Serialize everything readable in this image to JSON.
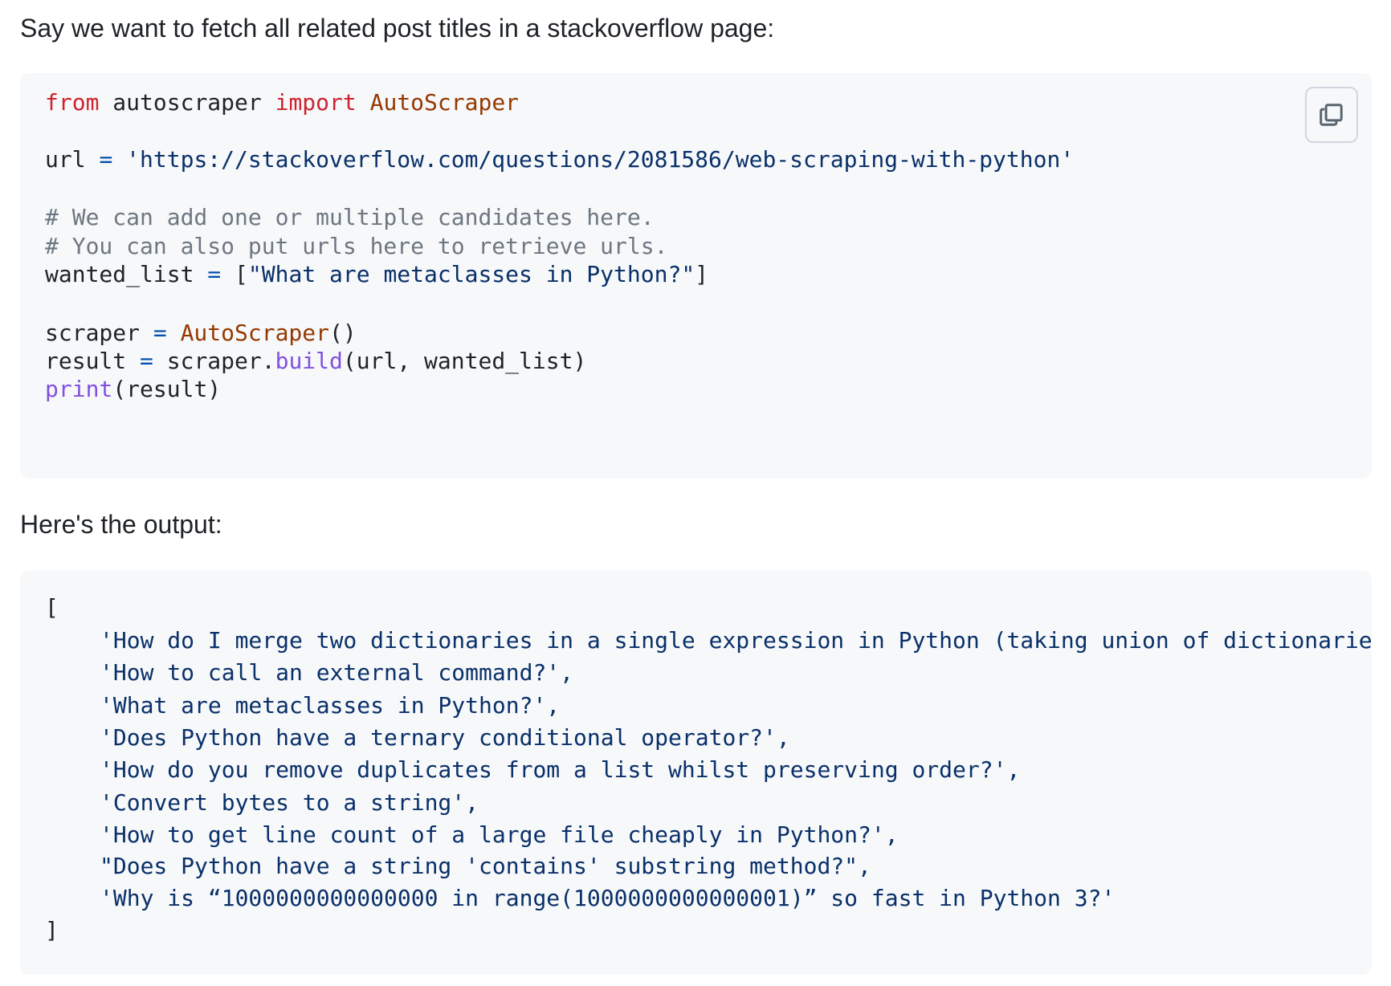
{
  "intro_text": "Say we want to fetch all related post titles in a stackoverflow page:",
  "outro_text": "Here's the output:",
  "copy_icon": "copy-icon",
  "colors": {
    "keyword": "#cf222e",
    "class_name": "#953800",
    "operator": "#0550ae",
    "string": "#0a3069",
    "comment": "#6e7781",
    "function": "#8250df",
    "code_background": "#f6f8fa"
  },
  "code": {
    "line1": {
      "kw_from": "from",
      "module": " autoscraper ",
      "kw_import": "import",
      "cls": " AutoScraper"
    },
    "line2": {
      "var": "url ",
      "op": "=",
      "str": " 'https://stackoverflow.com/questions/2081586/web-scraping-with-python'"
    },
    "comment1": "# We can add one or multiple candidates here.",
    "comment2": "# You can also put urls here to retrieve urls.",
    "line5": {
      "var": "wanted_list ",
      "op": "=",
      "open": " [",
      "str": "\"What are metaclasses in Python?\"",
      "close": "]"
    },
    "line6": {
      "var": "scraper ",
      "op": "=",
      "cls": " AutoScraper",
      "parens": "()"
    },
    "line7": {
      "var": "result ",
      "op": "=",
      "obj": " scraper.",
      "fn": "build",
      "args": "(url, wanted_list)"
    },
    "line8": {
      "fn": "print",
      "args": "(result)"
    }
  },
  "output": {
    "open_bracket": "[",
    "close_bracket": "]",
    "items": [
      "'How do I merge two dictionaries in a single expression in Python (taking union of dictionaries)?',",
      "'How to call an external command?',",
      "'What are metaclasses in Python?',",
      "'Does Python have a ternary conditional operator?',",
      "'How do you remove duplicates from a list whilst preserving order?',",
      "'Convert bytes to a string',",
      "'How to get line count of a large file cheaply in Python?',",
      "\"Does Python have a string 'contains' substring method?\",",
      "'Why is “1000000000000000 in range(1000000000000001)” so fast in Python 3?'"
    ]
  }
}
